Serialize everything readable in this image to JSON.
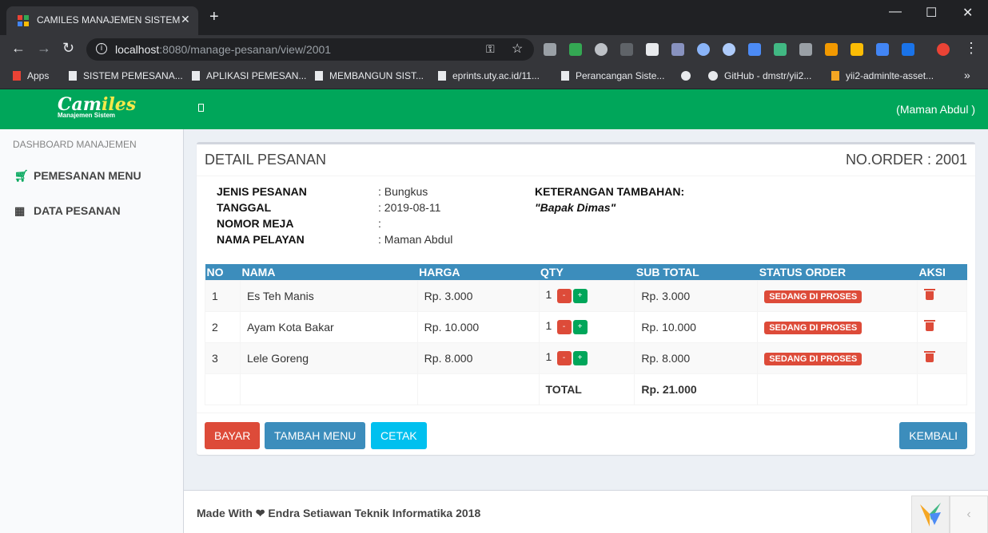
{
  "browser": {
    "tab_title": "CAMILES MANAJEMEN SISTEM",
    "tab_close": "✕",
    "new_tab": "+",
    "url_host": "localhost",
    "url_rest": ":8080/manage-pesanan/view/2001",
    "bookmarks": [
      "Apps",
      "SISTEM PEMESANA...",
      "APLIKASI PEMESAN...",
      "MEMBANGUN SIST...",
      "eprints.uty.ac.id/11...",
      "Perancangan Siste...",
      "GitHub - dmstr/yii2...",
      "yii2-adminlte-asset..."
    ],
    "more_bookmarks": "»"
  },
  "header": {
    "logo_main_a": "Cam",
    "logo_main_b": "iles",
    "logo_sub": "Manajemen Sistem",
    "user": "(Maman Abdul )"
  },
  "sidebar": {
    "header": "DASHBOARD MANAJEMEN",
    "items": [
      {
        "label": "PEMESANAN MENU",
        "icon": "cart-icon"
      },
      {
        "label": "DATA PESANAN",
        "icon": "dashboard-icon"
      }
    ]
  },
  "detail": {
    "title": "DETAIL PESANAN",
    "order_no": "NO.ORDER : 2001",
    "fields": [
      {
        "label": "JENIS PESANAN",
        "value": ": Bungkus"
      },
      {
        "label": "TANGGAL",
        "value": ": 2019-08-11"
      },
      {
        "label": "NOMOR MEJA",
        "value": ":"
      },
      {
        "label": "NAMA PELAYAN",
        "value": ": Maman Abdul"
      }
    ],
    "note_label": "KETERANGAN TAMBAHAN:",
    "note_value": "\"Bapak Dimas\""
  },
  "table": {
    "headers": [
      "NO",
      "NAMA",
      "HARGA",
      "QTY",
      "SUB TOTAL",
      "STATUS ORDER",
      "AKSI"
    ],
    "rows": [
      {
        "no": "1",
        "nama": "Es Teh Manis",
        "harga": "Rp. 3.000",
        "qty": "1",
        "subtotal": "Rp. 3.000",
        "status": "SEDANG DI PROSES"
      },
      {
        "no": "2",
        "nama": "Ayam Kota Bakar",
        "harga": "Rp. 10.000",
        "qty": "1",
        "subtotal": "Rp. 10.000",
        "status": "SEDANG DI PROSES"
      },
      {
        "no": "3",
        "nama": "Lele Goreng",
        "harga": "Rp. 8.000",
        "qty": "1",
        "subtotal": "Rp. 8.000",
        "status": "SEDANG DI PROSES"
      }
    ],
    "minus": "-",
    "plus": "+",
    "total_label": "TOTAL",
    "total_value": "Rp. 21.000"
  },
  "buttons": {
    "bayar": "BAYAR",
    "tambah": "TAMBAH MENU",
    "cetak": "CETAK",
    "kembali": "KEMBALI"
  },
  "footer": {
    "text_a": "Made With",
    "text_b": "Endra Setiawan Teknik Informatika 2018",
    "toggle": "‹"
  },
  "colors": {
    "brand_green": "#00a65a",
    "table_header": "#3c8dbc",
    "danger": "#dd4b39",
    "info": "#00c0ef"
  }
}
